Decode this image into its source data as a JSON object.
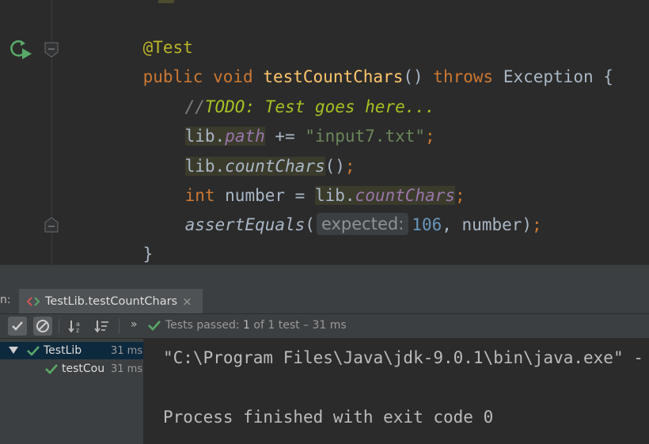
{
  "editor": {
    "annotation": "@Test",
    "signature": {
      "kw_public": "public",
      "kw_void": "void",
      "method_name": "testCountChars",
      "parens": "()",
      "kw_throws": "throws",
      "exception": "Exception",
      "brace_open": "{"
    },
    "comment": {
      "slashes": "//",
      "todo_text": "TODO: Test goes here..."
    },
    "line_path": {
      "obj": "lib",
      "dot": ".",
      "field": "path",
      "op": " += ",
      "string": "\"input7.txt\"",
      "semi": ";"
    },
    "line_call": {
      "obj": "lib",
      "dot": ".",
      "method": "countChars",
      "parens": "()",
      "semi": ";"
    },
    "line_assign": {
      "type": "int",
      "var": " number = ",
      "obj": "lib",
      "dot": ".",
      "field": "countChars",
      "semi": ";"
    },
    "line_assert": {
      "method": "assertEquals",
      "paren_open": "(",
      "hint": "expected:",
      "number": "106",
      "rest": ", number)",
      "semi": ";"
    },
    "brace_close": "}"
  },
  "run_panel": {
    "tab_prefix": "n:",
    "tab_label": "TestLib.testCountChars",
    "tab_close": "×",
    "more": "»",
    "status": {
      "prefix": "Tests passed: ",
      "count": "1",
      "of": " of 1 test – 31 ms"
    },
    "tree": {
      "root": {
        "label": "TestLib",
        "time": "31 ms"
      },
      "child": {
        "label": "testCou",
        "time": "31 ms"
      }
    },
    "console": {
      "line1": "\"C:\\Program Files\\Java\\jdk-9.0.1\\bin\\java.exe\" -",
      "line2": "Process finished with exit code 0"
    }
  },
  "colors": {
    "editor_bg": "#2b2b2b",
    "panel_bg": "#3c3f41",
    "keyword": "#cc7832",
    "method": "#ffc66d",
    "string": "#6a8759",
    "number": "#6897bb",
    "todo": "#a8c023",
    "field": "#9876aa",
    "pass_green": "#59a869"
  },
  "icons": [
    "run-test-icon",
    "fold-icon",
    "test-arrows-icon",
    "close-icon",
    "check-icon",
    "stop-icon",
    "sort-alpha-icon",
    "sort-duration-icon",
    "expand-tree-icon",
    "chevron-double-icon",
    "pass-check-icon"
  ]
}
